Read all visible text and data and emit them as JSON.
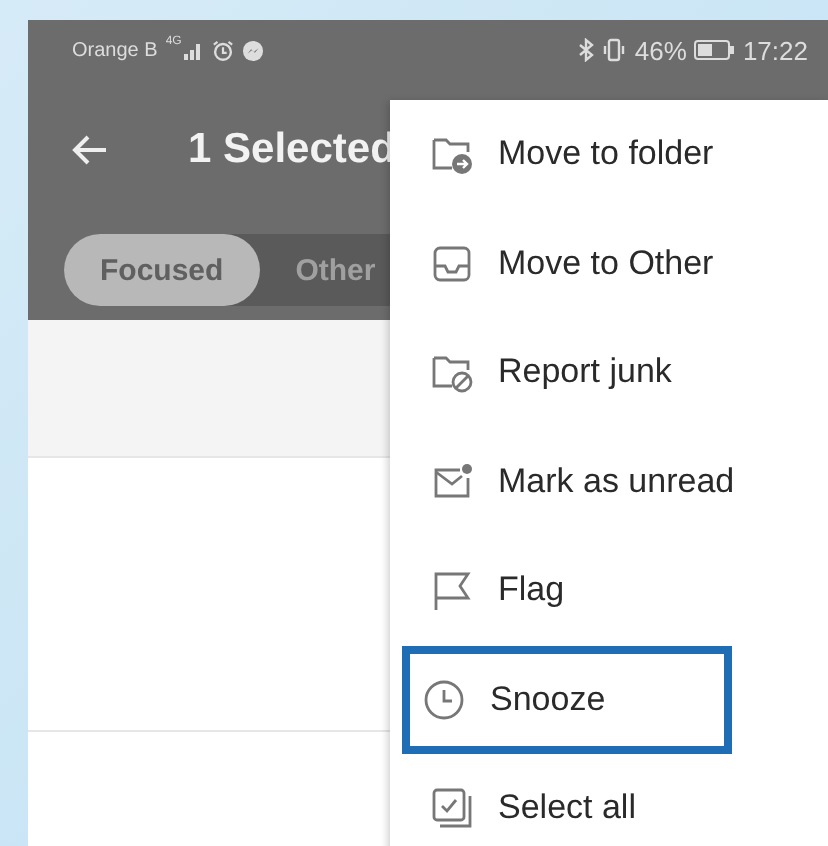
{
  "status_bar": {
    "carrier": "Orange B",
    "network": "4G",
    "battery": "46%",
    "time": "17:22"
  },
  "toolbar": {
    "title": "1 Selected"
  },
  "tabs": [
    {
      "label": "Focused",
      "selected": true
    },
    {
      "label": "Other",
      "selected": false
    }
  ],
  "menu": {
    "items": [
      {
        "label": "Move to folder",
        "kind": "folder-move",
        "highlighted": false
      },
      {
        "label": "Move to Other",
        "kind": "inbox",
        "highlighted": false
      },
      {
        "label": "Report junk",
        "kind": "junk",
        "highlighted": false
      },
      {
        "label": "Mark as unread",
        "kind": "unread",
        "highlighted": false
      },
      {
        "label": "Flag",
        "kind": "flag",
        "highlighted": false
      },
      {
        "label": "Snooze",
        "kind": "clock",
        "highlighted": true
      },
      {
        "label": "Select all",
        "kind": "select-all",
        "highlighted": false
      }
    ]
  }
}
